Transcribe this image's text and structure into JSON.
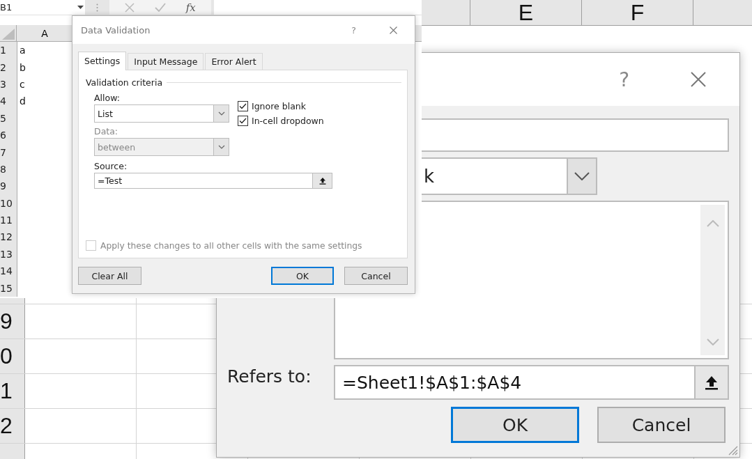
{
  "background_sheet": {
    "columns": [
      {
        "label": "E"
      },
      {
        "label": "F"
      }
    ],
    "rows": [
      "9",
      "0",
      "1",
      "2"
    ]
  },
  "name_dialog": {
    "help": "?",
    "scope_value": "k",
    "refers_to_label": "Refers to:",
    "refers_to_value": "=Sheet1!$A$1:$A$4",
    "buttons": [
      {
        "label": "OK",
        "default": true
      },
      {
        "label": "Cancel",
        "default": false
      }
    ]
  },
  "spreadsheet": {
    "name_box": "B1",
    "function_label": "fx",
    "column_header": "A",
    "rows": [
      {
        "number": "1",
        "value": "a"
      },
      {
        "number": "2",
        "value": "b"
      },
      {
        "number": "3",
        "value": "c"
      },
      {
        "number": "4",
        "value": "d"
      },
      {
        "number": "5"
      },
      {
        "number": "6"
      },
      {
        "number": "7"
      },
      {
        "number": "8"
      },
      {
        "number": "9"
      },
      {
        "number": "10"
      },
      {
        "number": "11"
      },
      {
        "number": "12"
      },
      {
        "number": "13"
      },
      {
        "number": "14"
      },
      {
        "number": "15"
      }
    ]
  },
  "data_validation": {
    "title": "Data Validation",
    "help": "?",
    "tabs": [
      {
        "label": "Settings",
        "selected": true
      },
      {
        "label": "Input Message",
        "selected": false
      },
      {
        "label": "Error Alert",
        "selected": false
      }
    ],
    "section": "Validation criteria",
    "allow": {
      "label": "Allow:",
      "value": "List",
      "disabled": false
    },
    "data": {
      "label": "Data:",
      "value": "between",
      "disabled": true
    },
    "source": {
      "label": "Source:",
      "value": "=Test"
    },
    "checkboxes": [
      {
        "label": "Ignore blank",
        "checked": true,
        "disabled": false
      },
      {
        "label": "In-cell dropdown",
        "checked": true,
        "disabled": false
      }
    ],
    "apply_all": {
      "label": "Apply these changes to all other cells with the same settings",
      "checked": false,
      "disabled": true
    },
    "clear_button": "Clear All",
    "buttons": [
      {
        "label": "OK",
        "default": true
      },
      {
        "label": "Cancel",
        "default": false
      }
    ]
  }
}
